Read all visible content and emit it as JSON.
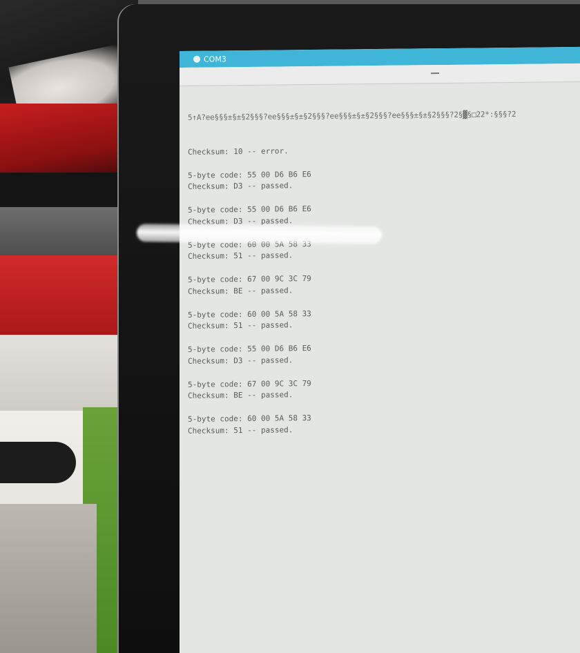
{
  "window": {
    "title": "COM3"
  },
  "serial": {
    "garbage_line": "5↑A?ee§§§±§±§2§§§?ee§§§±§±§2§§§?ee§§§±§±§2§§§?ee§§§±§±§2§§§?2§▓§□22*:§§§?2",
    "groups": [
      {
        "code": "",
        "checksum": "Checksum: 10 -- error."
      },
      {
        "code": "5-byte code: 55 00 D6 B6 E6",
        "checksum": "Checksum: D3 -- passed."
      },
      {
        "code": "5-byte code: 55 00 D6 B6 E6",
        "checksum": "Checksum: D3 -- passed."
      },
      {
        "code": "5-byte code: 60 00 5A 58 33",
        "checksum": "Checksum: 51 -- passed."
      },
      {
        "code": "5-byte code: 67 00 9C 3C 79",
        "checksum": "Checksum: BE -- passed."
      },
      {
        "code": "5-byte code: 60 00 5A 58 33",
        "checksum": "Checksum: 51 -- passed."
      },
      {
        "code": "5-byte code: 55 00 D6 B6 E6",
        "checksum": "Checksum: D3 -- passed."
      },
      {
        "code": "5-byte code: 67 00 9C 3C 79",
        "checksum": "Checksum: BE -- passed."
      },
      {
        "code": "5-byte code: 60 00 5A 58 33",
        "checksum": "Checksum: 51 -- passed."
      }
    ]
  },
  "colors": {
    "titlebar": "#3fb6d8",
    "screen_bg": "#e4e6e4",
    "text": "#5a5a5a"
  }
}
